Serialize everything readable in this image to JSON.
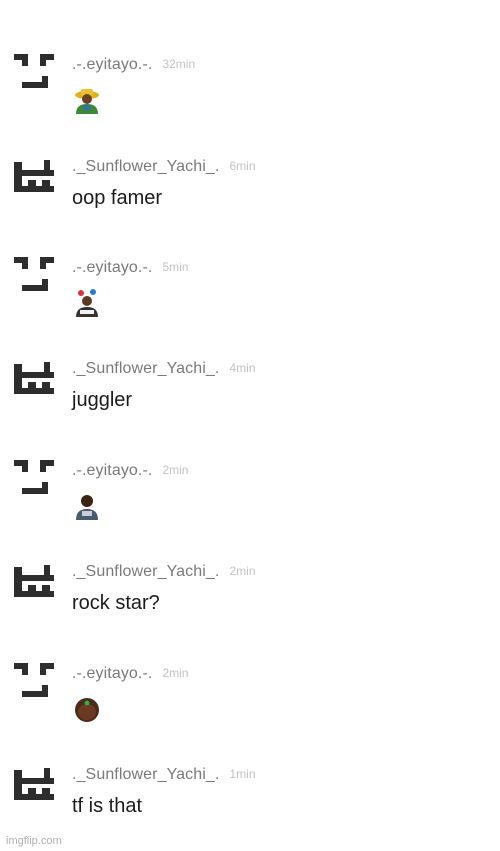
{
  "messages": [
    {
      "avatar": "face-avatar-icon",
      "username": ".-.eyitayo.-.",
      "time": "32min",
      "kind": "emoji",
      "content": "farmer-emoji-icon"
    },
    {
      "avatar": "building-avatar-icon",
      "username": "._Sunflower_Yachi_.",
      "time": "6min",
      "kind": "text",
      "content": "oop famer"
    },
    {
      "avatar": "face-avatar-icon",
      "username": ".-.eyitayo.-.",
      "time": "5min",
      "kind": "emoji",
      "content": "juggler-emoji-icon"
    },
    {
      "avatar": "building-avatar-icon",
      "username": "._Sunflower_Yachi_.",
      "time": "4min",
      "kind": "text",
      "content": "juggler"
    },
    {
      "avatar": "face-avatar-icon",
      "username": ".-.eyitayo.-.",
      "time": "2min",
      "kind": "emoji",
      "content": "singer-emoji-icon"
    },
    {
      "avatar": "building-avatar-icon",
      "username": "._Sunflower_Yachi_.",
      "time": "2min",
      "kind": "text",
      "content": "rock star?"
    },
    {
      "avatar": "face-avatar-icon",
      "username": ".-.eyitayo.-.",
      "time": "2min",
      "kind": "emoji",
      "content": "face-dot-emoji-icon"
    },
    {
      "avatar": "building-avatar-icon",
      "username": "._Sunflower_Yachi_.",
      "time": "1min",
      "kind": "text",
      "content": "tf is that"
    }
  ],
  "watermark": "imgflip.com",
  "colors": {
    "username": "#7a7a7a",
    "timestamp": "#c2c2c2",
    "message_text": "#1c1c1c",
    "avatar": "#2d2d2d"
  }
}
